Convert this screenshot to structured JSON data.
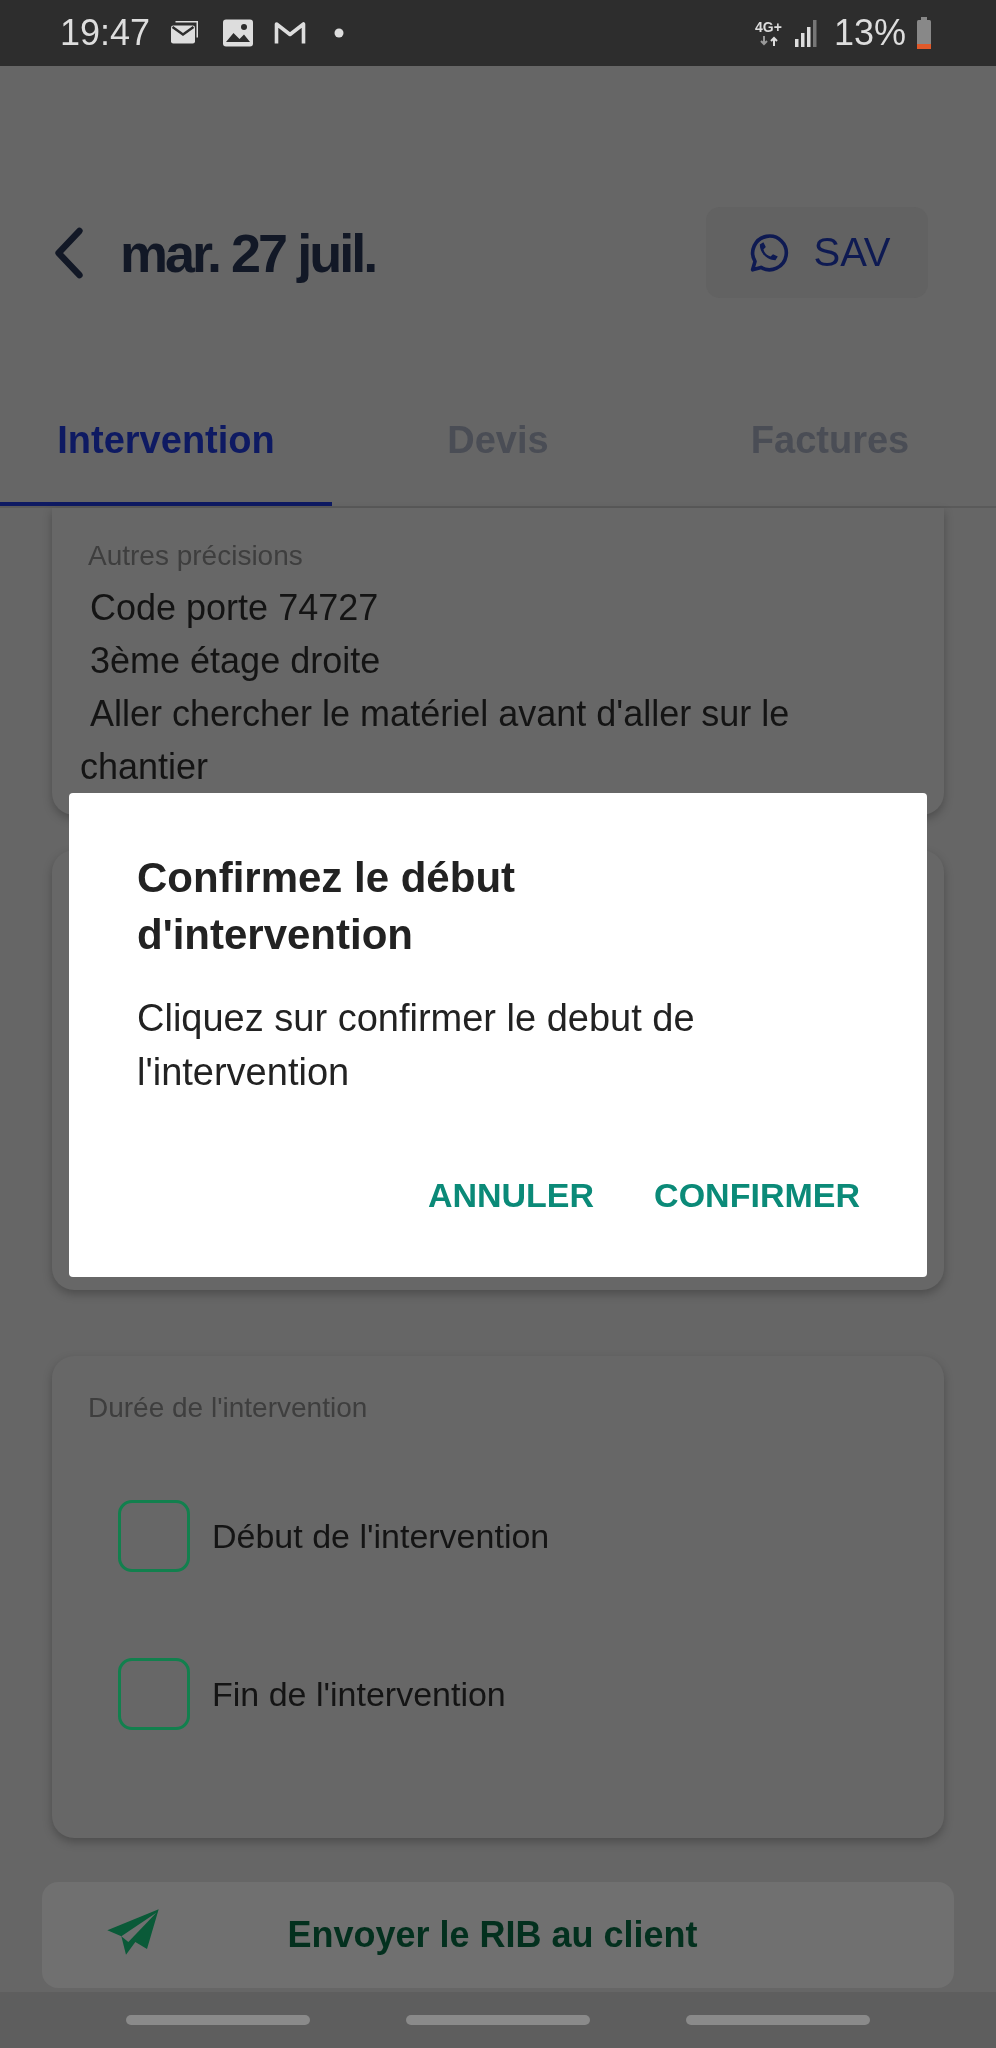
{
  "status_bar": {
    "time": "19:47",
    "network": "4G+",
    "battery": "13%"
  },
  "header": {
    "title": "mar. 27 juil.",
    "sav_button": "SAV"
  },
  "tabs": [
    {
      "label": "Intervention",
      "selected": true
    },
    {
      "label": "Devis",
      "selected": false
    },
    {
      "label": "Factures",
      "selected": false
    }
  ],
  "notes_card": {
    "label": "Autres précisions",
    "text": " Code porte 74727\n 3ème étage droite\n Aller chercher le matériel avant d'aller sur le chantier"
  },
  "duration_card": {
    "label": "Durée de l'intervention",
    "items": [
      {
        "label": "Début de l'intervention",
        "checked": false
      },
      {
        "label": "Fin de l'intervention",
        "checked": false
      }
    ]
  },
  "rib_button": "Envoyer le RIB au client",
  "dialog": {
    "title": "Confirmez le début d'intervention",
    "message": "Cliquez sur confirmer le debut de l'intervention",
    "buttons": [
      "ANNULER",
      "CONFIRMER"
    ]
  }
}
